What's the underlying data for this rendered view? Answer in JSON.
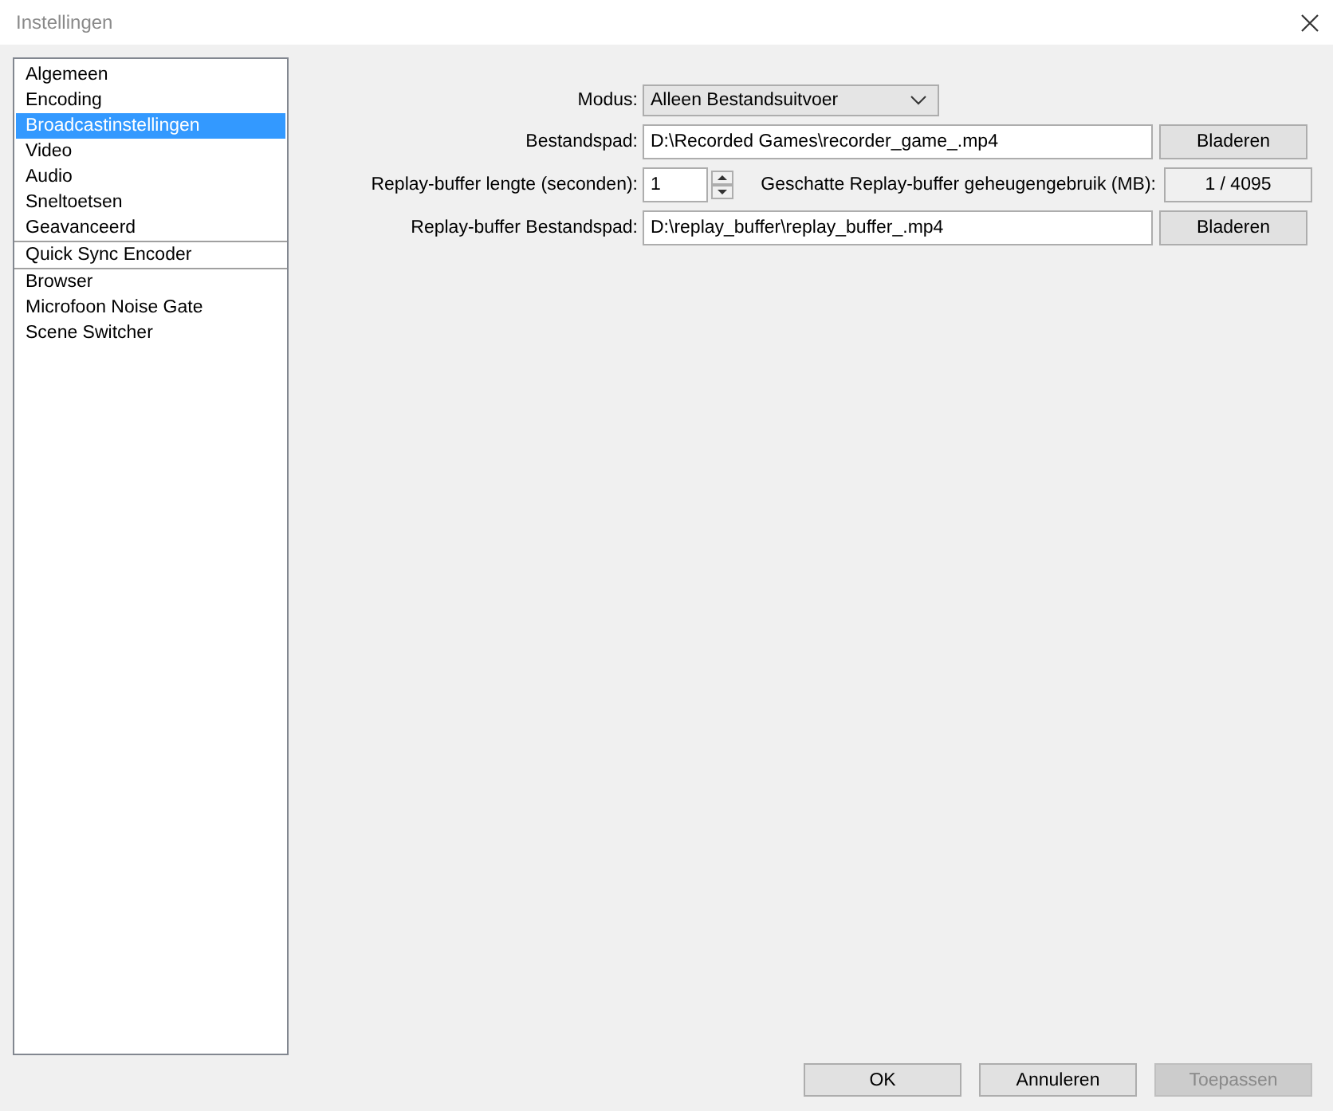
{
  "window": {
    "title": "Instellingen"
  },
  "sidebar": {
    "groups": [
      {
        "items": [
          {
            "label": "Algemeen",
            "selected": false
          },
          {
            "label": "Encoding",
            "selected": false
          },
          {
            "label": "Broadcastinstellingen",
            "selected": true
          },
          {
            "label": "Video",
            "selected": false
          },
          {
            "label": "Audio",
            "selected": false
          },
          {
            "label": "Sneltoetsen",
            "selected": false
          },
          {
            "label": "Geavanceerd",
            "selected": false
          }
        ]
      },
      {
        "items": [
          {
            "label": "Quick Sync Encoder",
            "selected": false
          }
        ]
      },
      {
        "items": [
          {
            "label": "Browser",
            "selected": false
          },
          {
            "label": "Microfoon Noise Gate",
            "selected": false
          },
          {
            "label": "Scene Switcher",
            "selected": false
          }
        ]
      }
    ]
  },
  "form": {
    "rows": [
      {
        "kind": "select",
        "label": "Modus:",
        "value": "Alleen Bestandsuitvoer"
      },
      {
        "kind": "path",
        "label": "Bestandspad:",
        "value": "D:\\Recorded Games\\recorder_game_.mp4",
        "button": "Bladeren"
      },
      {
        "kind": "spin",
        "label": "Replay-buffer lengte (seconden):",
        "value": "1",
        "info_label": "Geschatte Replay-buffer geheugengebruik (MB):",
        "info_value": "1 / 4095"
      },
      {
        "kind": "path",
        "label": "Replay-buffer Bestandspad:",
        "value": "D:\\replay_buffer\\replay_buffer_.mp4",
        "button": "Bladeren"
      }
    ]
  },
  "buttons": [
    {
      "label": "OK",
      "disabled": false
    },
    {
      "label": "Annuleren",
      "disabled": false
    },
    {
      "label": "Toepassen",
      "disabled": true
    }
  ]
}
